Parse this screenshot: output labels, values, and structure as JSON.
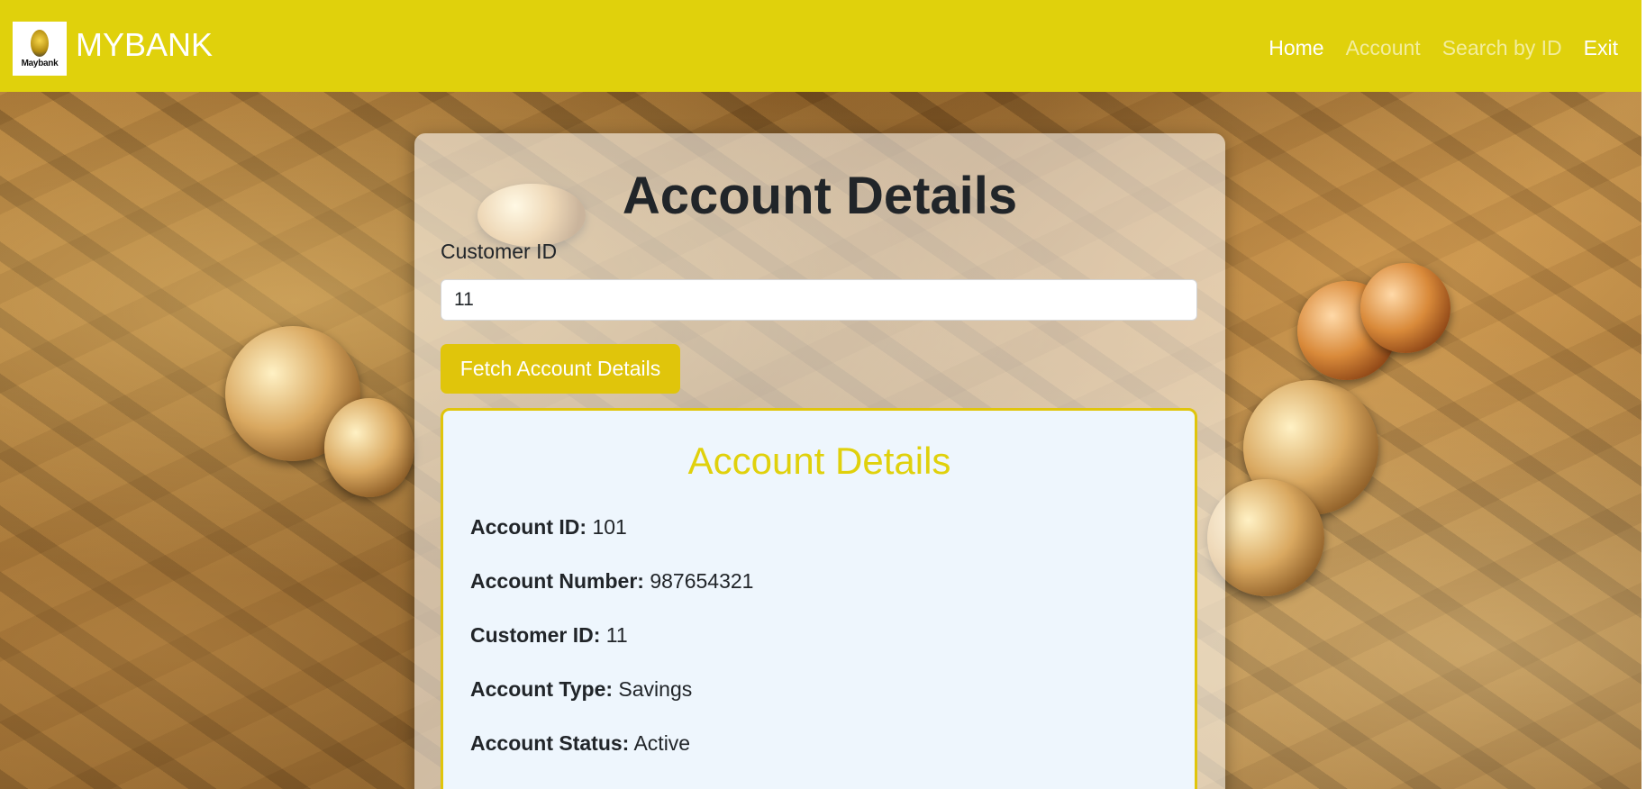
{
  "navbar": {
    "logo_text": "Maybank",
    "brand": "MYBANK",
    "links": [
      "Home",
      "Account",
      "Search by ID",
      "Exit"
    ]
  },
  "form": {
    "title": "Account Details",
    "customer_id_label": "Customer ID",
    "customer_id_value": "11",
    "fetch_button": "Fetch Account Details"
  },
  "details": {
    "title": "Account Details",
    "rows": [
      {
        "label": "Account ID:",
        "value": "101"
      },
      {
        "label": "Account Number:",
        "value": "987654321"
      },
      {
        "label": "Customer ID:",
        "value": "11"
      },
      {
        "label": "Account Type:",
        "value": "Savings"
      },
      {
        "label": "Account Status:",
        "value": "Active"
      }
    ]
  },
  "colors": {
    "navbar": "#e0d10c",
    "button": "#e0c50b",
    "details_title": "#e0d10c",
    "details_bg": "#eef6fd"
  }
}
